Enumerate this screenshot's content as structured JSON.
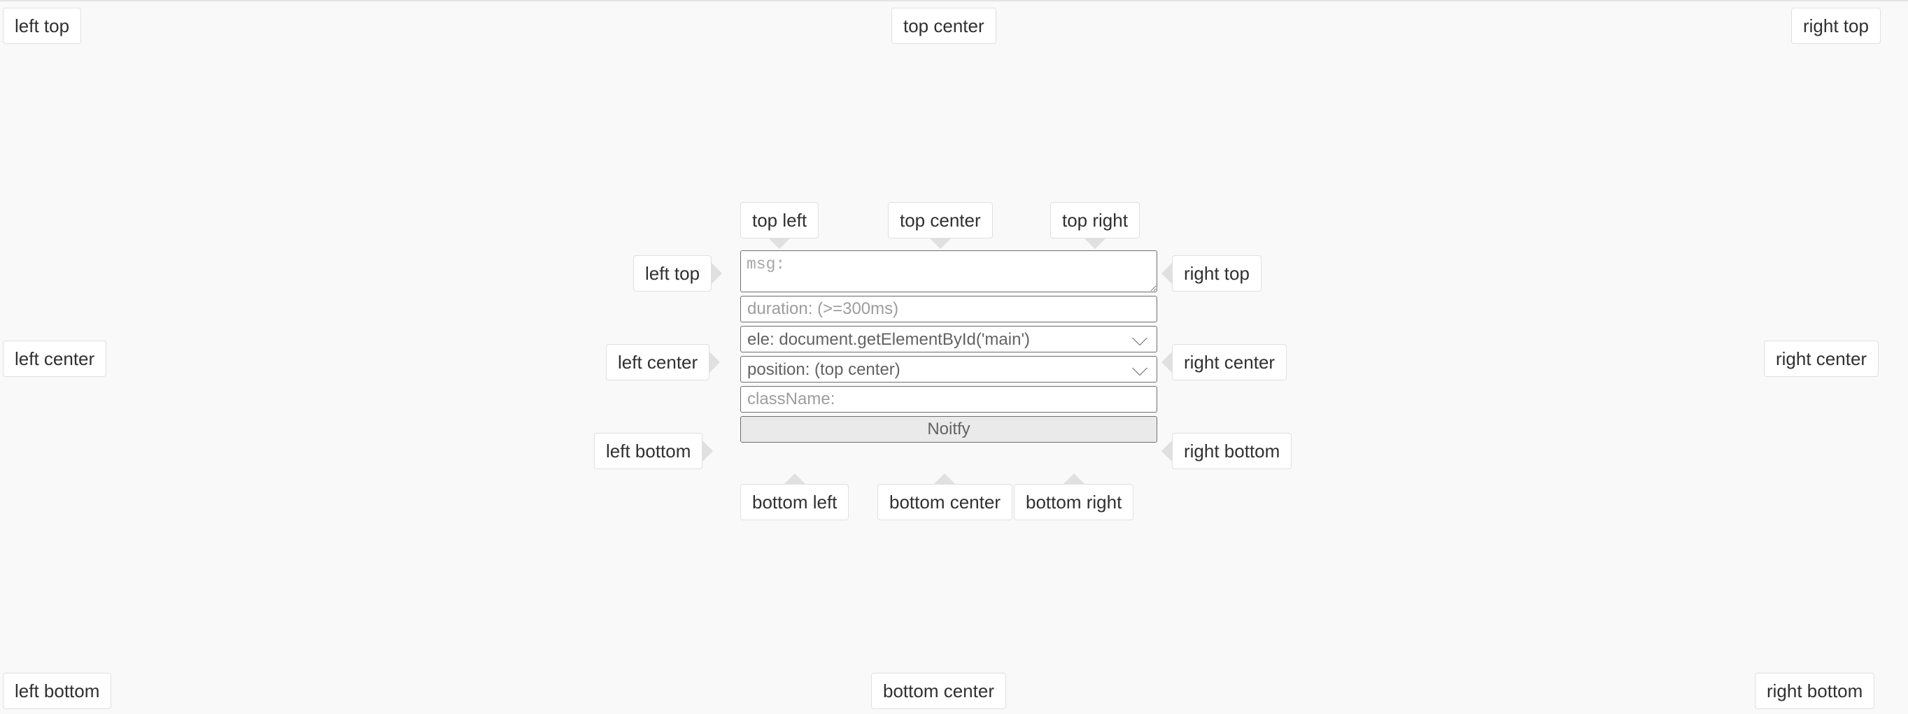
{
  "page": {
    "background": "#f9f9f9",
    "bubble_bg": "#ffffff",
    "bubble_border": "#e0e0e0",
    "arrow_color": "#e0e0e0",
    "text_color": "#303030",
    "field_border": "#6f6f6f",
    "button_bg": "#eaeaea"
  },
  "viewport_tips": {
    "left_top": "left top",
    "top_center": "top center",
    "right_top": "right top",
    "left_center": "left center",
    "right_center": "right center",
    "left_bottom": "left bottom",
    "bottom_center": "bottom center",
    "right_bottom": "right bottom"
  },
  "element_tips": {
    "top_left": "top left",
    "top_center": "top center",
    "top_right": "top right",
    "left_top": "left top",
    "right_top": "right top",
    "left_center": "left center",
    "right_center": "right center",
    "left_bottom": "left bottom",
    "right_bottom": "right bottom",
    "bottom_left": "bottom left",
    "bottom_center": "bottom center",
    "bottom_right": "bottom right"
  },
  "form": {
    "msg": {
      "placeholder": "msg:",
      "value": ""
    },
    "duration": {
      "placeholder": "duration: (>=300ms)",
      "value": ""
    },
    "element_select": {
      "selected": "ele: document.getElementById('main')",
      "options": [
        "ele: document.getElementById('main')"
      ]
    },
    "position_select": {
      "selected": "position: (top center)",
      "options": [
        "position: (top center)"
      ]
    },
    "class_name": {
      "placeholder": "className:",
      "value": ""
    },
    "submit_label": "Noitfy"
  }
}
